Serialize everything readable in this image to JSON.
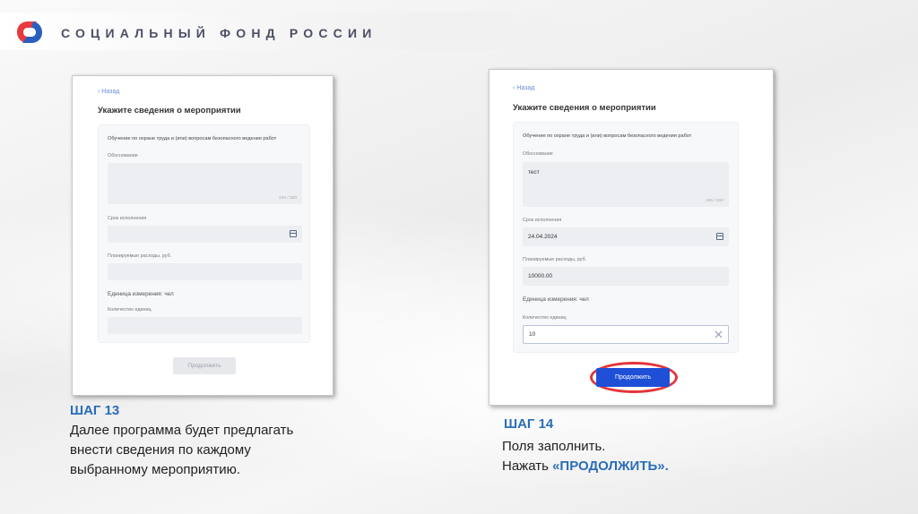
{
  "header": {
    "org_name": "СОЦИАЛЬНЫЙ ФОНД РОССИИ",
    "logo_icon": "sfr-logo-icon",
    "colors": {
      "logo_red": "#e8393e",
      "logo_blue": "#2b5fbf",
      "title": "#4a4f63"
    }
  },
  "left_screen": {
    "back_label": "‹ Назад",
    "page_title": "Укажите сведения о мероприятии",
    "card_title": "Обучение по охране труда и (или) вопросам безопасного ведения работ",
    "justification_label": "Обоснование",
    "justification_value": "",
    "justification_counter": "200 / 300",
    "deadline_label": "Срок исполнения",
    "deadline_value": "",
    "expenses_label": "Планируемые расходы, руб.",
    "expenses_value": "",
    "unit_text": "Единица измерения: чел",
    "quantity_label": "Количество единиц",
    "quantity_value": "",
    "continue_label": "Продолжить"
  },
  "right_screen": {
    "back_label": "‹ Назад",
    "page_title": "Укажите сведения о мероприятии",
    "card_title": "Обучение по охране труда и (или) вопросам безопасного ведения работ",
    "justification_label": "Обоснование",
    "justification_value": "тест",
    "justification_counter": "196 / 200",
    "deadline_label": "Срок исполнения",
    "deadline_value": "24.04.2024",
    "expenses_label": "Планируемые расходы, руб.",
    "expenses_value": "10000.00",
    "unit_text": "Единица измерения: чел",
    "quantity_label": "Количество единиц",
    "quantity_value": "10",
    "clear_icon": "close-icon",
    "continue_label": "Продолжить",
    "highlight_color": "#e3343a"
  },
  "step13": {
    "title": "ШАГ 13",
    "lines": [
      "Далее программа будет предлагать",
      "внести сведения по каждому",
      "выбранному мероприятию."
    ]
  },
  "step14": {
    "title": "ШАГ 14",
    "line1": "Поля заполнить.",
    "line2_prefix": "Нажать ",
    "line2_accent": "«ПРОДОЛЖИТЬ»."
  }
}
